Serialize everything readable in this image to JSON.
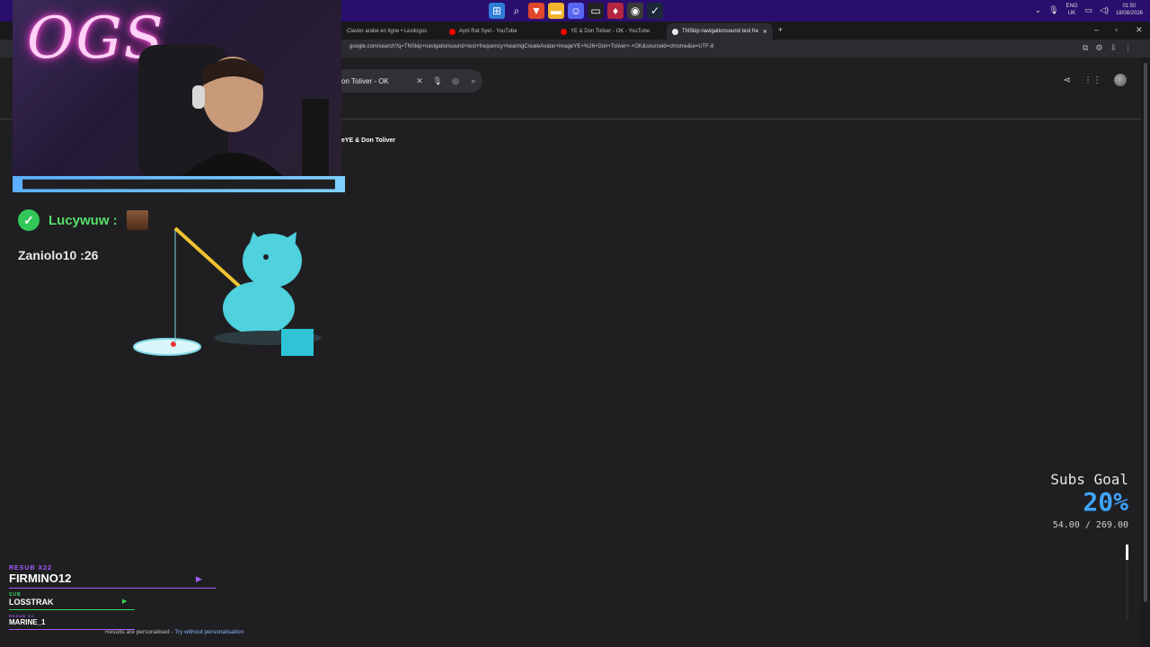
{
  "taskbar": {
    "language": "ENG",
    "region": "UK",
    "time": "01:50",
    "date": "18/08/2026"
  },
  "browser": {
    "tabs": [
      {
        "label": "Clavier arabe en ligne • Lexilogos"
      },
      {
        "label": "Ayni Rat Syel - YouTube"
      },
      {
        "label": "YE & Don Toliver - OK - YouTube"
      },
      {
        "label": "TNSkip navigationsound test fre"
      }
    ],
    "url": "google.com/search?q=TNSkip+navigationsound+test+frequency+hearingCreateAvatar+imageYE+%26+Don+Toliver+-+OK&sourceid=chrome&ie=UTF-8"
  },
  "search": {
    "query": "on Toliver - OK",
    "result_title": "eYE & Don Toliver",
    "footer_text": "Results are personalised - ",
    "footer_link": "Try without personalisation"
  },
  "overlay": {
    "neon_sign": "OGS",
    "alert_top_name": "Lucywuw :",
    "alert_second": "Zaniolo10 :26",
    "subs_goal_label": "Subs Goal",
    "subs_goal_percent": "20%",
    "subs_goal_progress": 0.2,
    "subs_goal_amount": "54.00 / 269.00",
    "recent_subs": [
      {
        "type": "RESUB X22",
        "name": "FIRMINO12",
        "color": "#a35cff"
      },
      {
        "type": "SUB",
        "name": "LOSSTRAK",
        "color": "#3ad45a"
      },
      {
        "type": "RESUB X6",
        "name": "MARINE_1",
        "color": "#a35cff"
      }
    ]
  },
  "colors": {
    "taskbar": "#2a0e6e",
    "page_bg": "#1f1f21",
    "goal_accent": "#3fa3ff",
    "alert_green": "#55e06a"
  }
}
